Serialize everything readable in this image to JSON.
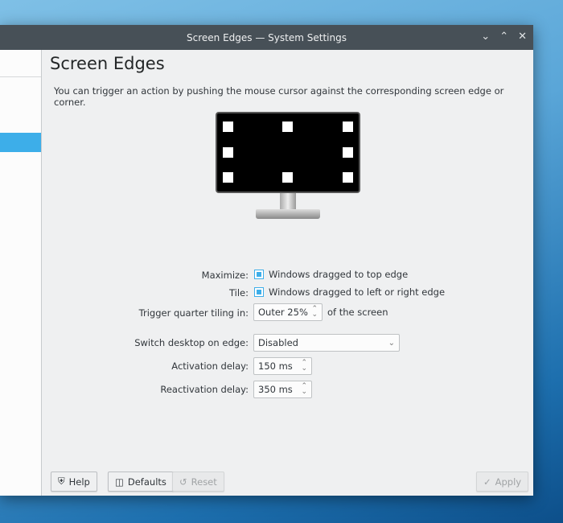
{
  "window": {
    "title": "Screen Edges — System Settings",
    "controls": [
      "minimize",
      "maximize",
      "close"
    ]
  },
  "page": {
    "title": "Screen Edges",
    "description": "You can trigger an action by pushing the mouse cursor against the corresponding screen edge or corner."
  },
  "form": {
    "maximize": {
      "label": "Maximize:",
      "text": "Windows dragged to top edge",
      "checked": true
    },
    "tile": {
      "label": "Tile:",
      "text": "Windows dragged to left or right edge",
      "checked": true
    },
    "quarter": {
      "label": "Trigger quarter tiling in:",
      "value": "Outer 25%",
      "suffix": "of the screen"
    },
    "switch_desktop": {
      "label": "Switch desktop on edge:",
      "value": "Disabled"
    },
    "activation": {
      "label": "Activation delay:",
      "value": "150 ms"
    },
    "reactivation": {
      "label": "Reactivation delay:",
      "value": "350 ms"
    }
  },
  "buttons": {
    "help": "Help",
    "defaults": "Defaults",
    "reset": "Reset",
    "apply": "Apply"
  },
  "colors": {
    "accent": "#3daee9",
    "titlebar": "#475057"
  }
}
